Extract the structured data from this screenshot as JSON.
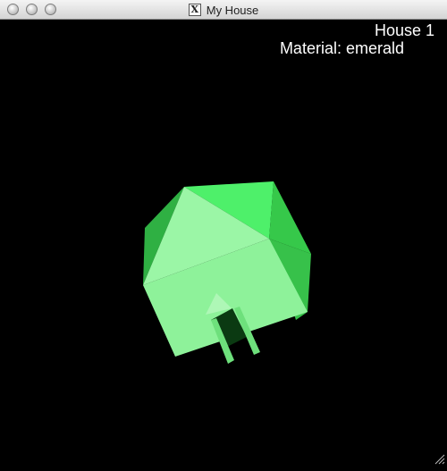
{
  "window": {
    "title": "My House",
    "title_icon": "x11-icon"
  },
  "overlay": {
    "house": "House 1",
    "material": "Material: emerald"
  },
  "scene": {
    "object": "house",
    "material": "emerald",
    "colors": {
      "front": "#8ef29a",
      "roof_front": "#9bf6a6",
      "roof_right": "#4fdd61",
      "side_right": "#37c14a",
      "side_left": "#2fb043",
      "roof_back": "#52f26c",
      "door": "#0b3a12",
      "chimney": "#5ee173"
    }
  }
}
